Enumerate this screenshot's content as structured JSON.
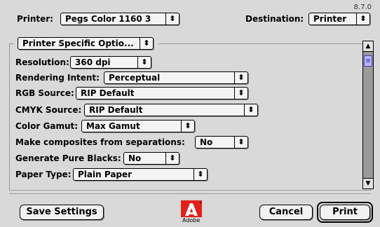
{
  "version": "8.7.0",
  "printer": {
    "label": "Printer:",
    "value": "Pegs Color 1160 3"
  },
  "destination": {
    "label": "Destination:",
    "value": "Printer"
  },
  "panel_select": {
    "value": "Printer Specific Optio..."
  },
  "settings": [
    {
      "label": "Resolution:",
      "value": "360 dpi"
    },
    {
      "label": "Rendering Intent:",
      "value": "Perceptual"
    },
    {
      "label": "RGB Source:",
      "value": "RIP Default"
    },
    {
      "label": "CMYK Source:",
      "value": "RIP Default"
    },
    {
      "label": "Color Gamut:",
      "value": "Max Gamut"
    },
    {
      "label": "Make composites from separations:",
      "value": "No"
    },
    {
      "label": "Generate Pure Blacks:",
      "value": "No"
    },
    {
      "label": "Paper Type:",
      "value": "Plain Paper"
    }
  ],
  "buttons": {
    "save": "Save Settings",
    "cancel": "Cancel",
    "print": "Print"
  },
  "logo": {
    "name": "adobe-logo",
    "text": "Adobe"
  },
  "icons": {
    "popup_arrow": "up-down-arrows-icon",
    "scroll_up": "scroll-up-arrow-icon",
    "scroll_down": "scroll-down-arrow-icon"
  }
}
